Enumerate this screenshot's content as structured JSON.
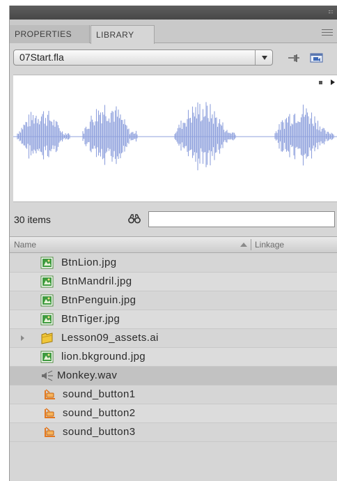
{
  "tabs": [
    {
      "label": "PROPERTIES"
    },
    {
      "label": "LIBRARY"
    }
  ],
  "document": {
    "selected": "07Start.fla"
  },
  "library": {
    "count": "30 items",
    "search_value": "",
    "columns": {
      "name": "Name",
      "linkage": "Linkage"
    },
    "items": [
      {
        "label": "BtnLion.jpg",
        "icon": "bitmap-icon"
      },
      {
        "label": "BtnMandril.jpg",
        "icon": "bitmap-icon"
      },
      {
        "label": "BtnPenguin.jpg",
        "icon": "bitmap-icon"
      },
      {
        "label": "BtnTiger.jpg",
        "icon": "bitmap-icon"
      },
      {
        "label": "Lesson09_assets.ai",
        "icon": "folder-icon"
      },
      {
        "label": "lion.bkground.jpg",
        "icon": "bitmap-icon"
      },
      {
        "label": "Monkey.wav",
        "icon": "sound-icon"
      },
      {
        "label": "sound_button1",
        "icon": "button-symbol-icon"
      },
      {
        "label": "sound_button2",
        "icon": "button-symbol-icon"
      },
      {
        "label": "sound_button3",
        "icon": "button-symbol-icon"
      }
    ]
  },
  "colors": {
    "waveform": "#8fa1dd",
    "bitmap_icon": "#3f9b3f",
    "folder_icon": "#f0c63a"
  }
}
